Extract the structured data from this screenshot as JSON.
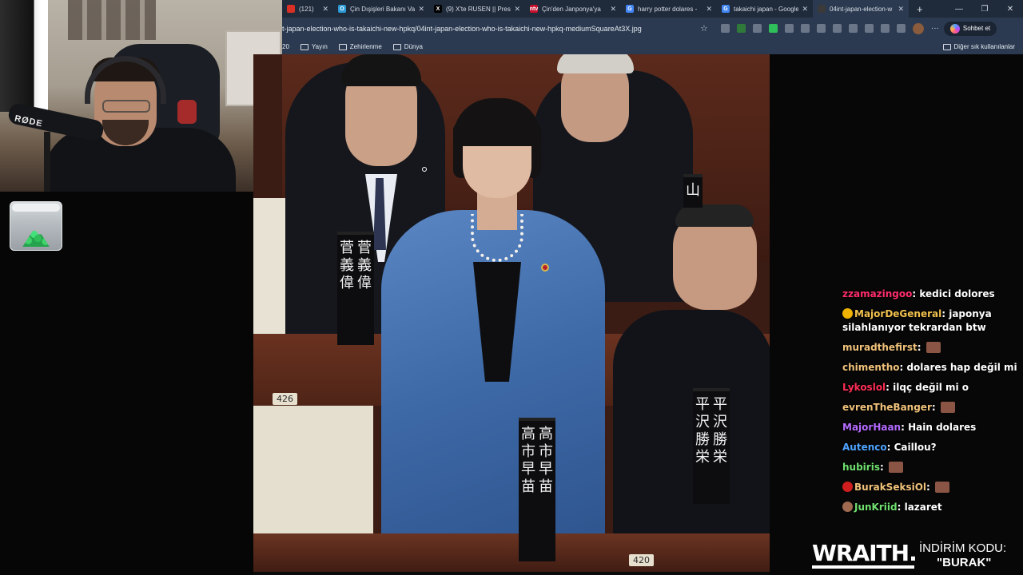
{
  "browser": {
    "tabs": [
      {
        "label": "(121)",
        "icon_color": "#d93025",
        "icon_text": ""
      },
      {
        "label": "Çin Dışişleri Bakanı Va",
        "icon_color": "#2b9ad6",
        "icon_text": "O"
      },
      {
        "label": "(9) X'te RUSEN || Press",
        "icon_color": "#000000",
        "icon_text": "X"
      },
      {
        "label": "Çin'den Janponya'ya",
        "icon_color": "#c8102e",
        "icon_text": "ntv"
      },
      {
        "label": "harry potter dolares -",
        "icon_color": "#4285f4",
        "icon_text": "G"
      },
      {
        "label": "takaichi japan - Google",
        "icon_color": "#4285f4",
        "icon_text": "G"
      },
      {
        "label": "04int-japan-election-w",
        "icon_color": "#3a3a3a",
        "icon_text": "",
        "active": true
      }
    ],
    "url": "t-japan-election-who-is-takaichi-new-hpkq/04int-japan-election-who-is-takaichi-new-hpkq-mediumSquareAt3X.jpg",
    "chat_button": "Sohbet et",
    "bookmarks": [
      "20",
      "Yayın",
      "Zehirlenme",
      "Dünya"
    ],
    "other_bookmarks": "Diğer sık kullanılanlar"
  },
  "webcam": {
    "mic_brand": "RØDE"
  },
  "photo": {
    "plates": {
      "left": [
        "菅",
        "義",
        "偉"
      ],
      "center": [
        "高",
        "市",
        "早",
        "苗"
      ],
      "right": [
        "平",
        "沢",
        "勝",
        "栄"
      ],
      "top_right": [
        "山"
      ]
    },
    "desk_numbers": [
      "426",
      "420"
    ]
  },
  "chat": {
    "messages": [
      {
        "user": "zzamazingoo",
        "color": "#ff2d6b",
        "text": "kedici dolores"
      },
      {
        "user": "MajorDeGeneral",
        "color": "#f2c14e",
        "text": "japonya silahlanıyor tekrardan btw",
        "badge": "#f0b400"
      },
      {
        "user": "muradthefirst",
        "color": "#f0c27a",
        "text": "",
        "emote": true
      },
      {
        "user": "chimentho",
        "color": "#f0c27a",
        "text": "dolares hap değil mi"
      },
      {
        "user": "Lykoslol",
        "color": "#ff2d55",
        "text": "ilqç değil mi o"
      },
      {
        "user": "evrenTheBanger",
        "color": "#f0c27a",
        "text": "",
        "emote": true
      },
      {
        "user": "MajorHaan",
        "color": "#b36bff",
        "text": "Hain dolares"
      },
      {
        "user": "Autenco",
        "color": "#4fa3ff",
        "text": "Caillou?"
      },
      {
        "user": "hubiris",
        "color": "#6fe06f",
        "text": "",
        "emote": true
      },
      {
        "user": "BurakSeksiOl",
        "color": "#f0c27a",
        "text": "",
        "emote": true,
        "badge": "#d01e1e"
      },
      {
        "user": "JunKriid",
        "color": "#6fe06f",
        "text": "lazaret",
        "badge": "#a06a50"
      }
    ]
  },
  "promo": {
    "brand": "WRAITH.",
    "code_label": "İNDİRİM KODU:",
    "code": "\"BURAK\""
  }
}
